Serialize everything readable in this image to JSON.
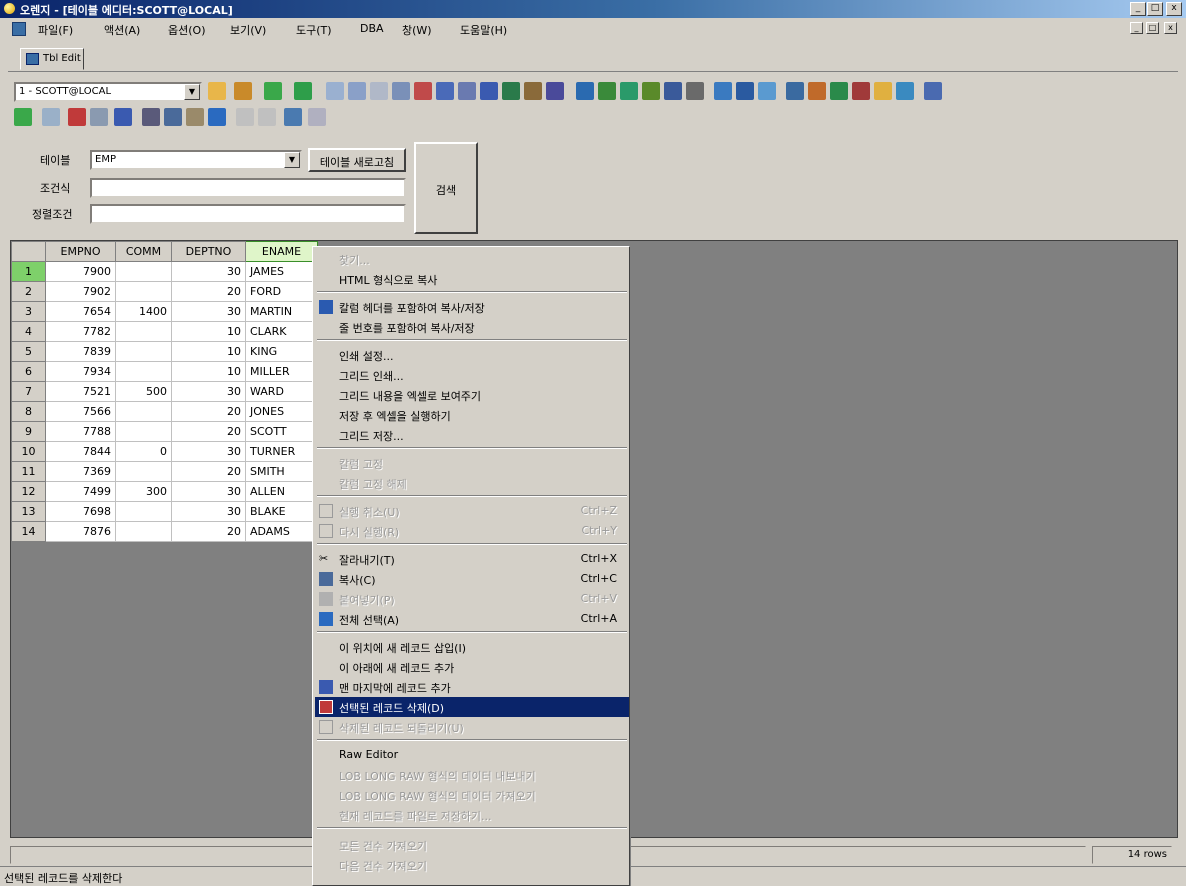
{
  "window": {
    "title": "오렌지 - [테이블 에디터:SCOTT@LOCAL]",
    "minimize": "_",
    "maximize": "□",
    "close": "x"
  },
  "menubar": [
    "파일(F)",
    "액션(A)",
    "옵션(O)",
    "보기(V)",
    "도구(T)",
    "DBA",
    "창(W)",
    "도움말(H)"
  ],
  "tab": {
    "label": "Tbl Edit"
  },
  "toolbar": {
    "connection": "1 - SCOTT@LOCAL"
  },
  "search": {
    "table_label": "테이블",
    "table_value": "EMP",
    "refresh_button": "테이블 새로고침",
    "condition_label": "조건식",
    "condition_value": "",
    "sort_label": "정렬조건",
    "sort_value": "",
    "search_button": "검색"
  },
  "grid": {
    "columns": [
      "EMPNO",
      "COMM",
      "DEPTNO",
      "ENAME"
    ],
    "rows": [
      [
        "1",
        "7900",
        "",
        "30",
        "JAMES"
      ],
      [
        "2",
        "7902",
        "",
        "20",
        "FORD"
      ],
      [
        "3",
        "7654",
        "1400",
        "30",
        "MARTIN"
      ],
      [
        "4",
        "7782",
        "",
        "10",
        "CLARK"
      ],
      [
        "5",
        "7839",
        "",
        "10",
        "KING"
      ],
      [
        "6",
        "7934",
        "",
        "10",
        "MILLER"
      ],
      [
        "7",
        "7521",
        "500",
        "30",
        "WARD"
      ],
      [
        "8",
        "7566",
        "",
        "20",
        "JONES"
      ],
      [
        "9",
        "7788",
        "",
        "20",
        "SCOTT"
      ],
      [
        "10",
        "7844",
        "0",
        "30",
        "TURNER"
      ],
      [
        "11",
        "7369",
        "",
        "20",
        "SMITH"
      ],
      [
        "12",
        "7499",
        "300",
        "30",
        "ALLEN"
      ],
      [
        "13",
        "7698",
        "",
        "30",
        "BLAKE"
      ],
      [
        "14",
        "7876",
        "",
        "20",
        "ADAMS"
      ]
    ]
  },
  "context_menu": {
    "items": [
      {
        "label": "찾기...",
        "shortcut": "",
        "disabled": true,
        "icon": ""
      },
      {
        "label": "HTML 형식으로 복사",
        "shortcut": "",
        "disabled": false,
        "icon": ""
      },
      {
        "label": "칼럼 헤더를 포함하여 복사/저장",
        "shortcut": "",
        "disabled": false,
        "icon": "grid-header-icon"
      },
      {
        "label": "줄 번호를 포함하여 복사/저장",
        "shortcut": "",
        "disabled": false,
        "icon": ""
      },
      {
        "label": "인쇄 설정...",
        "shortcut": "",
        "disabled": false,
        "icon": ""
      },
      {
        "label": "그리드 인쇄...",
        "shortcut": "",
        "disabled": false,
        "icon": ""
      },
      {
        "label": "그리드 내용을 엑셀로 보여주기",
        "shortcut": "",
        "disabled": false,
        "icon": ""
      },
      {
        "label": "저장 후 엑셀을 실행하기",
        "shortcut": "",
        "disabled": false,
        "icon": ""
      },
      {
        "label": "그리드 저장...",
        "shortcut": "",
        "disabled": false,
        "icon": ""
      },
      {
        "label": "칼럼 고정",
        "shortcut": "",
        "disabled": true,
        "icon": ""
      },
      {
        "label": "칼럼 고정 해제",
        "shortcut": "",
        "disabled": true,
        "icon": ""
      },
      {
        "label": "실행 취소(U)",
        "shortcut": "Ctrl+Z",
        "disabled": true,
        "icon": "undo-icon"
      },
      {
        "label": "다시 실행(R)",
        "shortcut": "Ctrl+Y",
        "disabled": true,
        "icon": "redo-icon"
      },
      {
        "label": "잘라내기(T)",
        "shortcut": "Ctrl+X",
        "disabled": false,
        "icon": "cut-icon"
      },
      {
        "label": "복사(C)",
        "shortcut": "Ctrl+C",
        "disabled": false,
        "icon": "copy-icon"
      },
      {
        "label": "붙여넣기(P)",
        "shortcut": "Ctrl+V",
        "disabled": true,
        "icon": "paste-icon"
      },
      {
        "label": "전체 선택(A)",
        "shortcut": "Ctrl+A",
        "disabled": false,
        "icon": "select-all-icon"
      },
      {
        "label": "이 위치에 새 레코드 삽입(I)",
        "shortcut": "",
        "disabled": false,
        "icon": ""
      },
      {
        "label": "이 아래에 새 레코드 추가",
        "shortcut": "",
        "disabled": false,
        "icon": ""
      },
      {
        "label": "맨 마지막에 레코드 추가",
        "shortcut": "",
        "disabled": false,
        "icon": "append-record-icon"
      },
      {
        "label": "선택된 레코드 삭제(D)",
        "shortcut": "",
        "disabled": false,
        "icon": "delete-record-icon"
      },
      {
        "label": "삭제된 레코드 되돌리기(U)",
        "shortcut": "",
        "disabled": true,
        "icon": "undelete-icon"
      },
      {
        "label": "Raw Editor",
        "shortcut": "",
        "disabled": false,
        "icon": ""
      },
      {
        "label": "LOB LONG RAW 형식의 데이터 내보내기",
        "shortcut": "",
        "disabled": true,
        "icon": ""
      },
      {
        "label": "LOB LONG RAW 형식의 데이터 가져오기",
        "shortcut": "",
        "disabled": true,
        "icon": ""
      },
      {
        "label": "현재 레코드를 파일로 저장하기...",
        "shortcut": "",
        "disabled": true,
        "icon": ""
      },
      {
        "label": "모든 건수 가져오기",
        "shortcut": "",
        "disabled": true,
        "icon": ""
      },
      {
        "label": "다음 건수 가져오기",
        "shortcut": "",
        "disabled": true,
        "icon": ""
      }
    ],
    "highlighted": "선택된 레코드 삭제(D)"
  },
  "status": {
    "row_count": "14 rows",
    "message": "선택된 레코드를 삭제한다"
  }
}
